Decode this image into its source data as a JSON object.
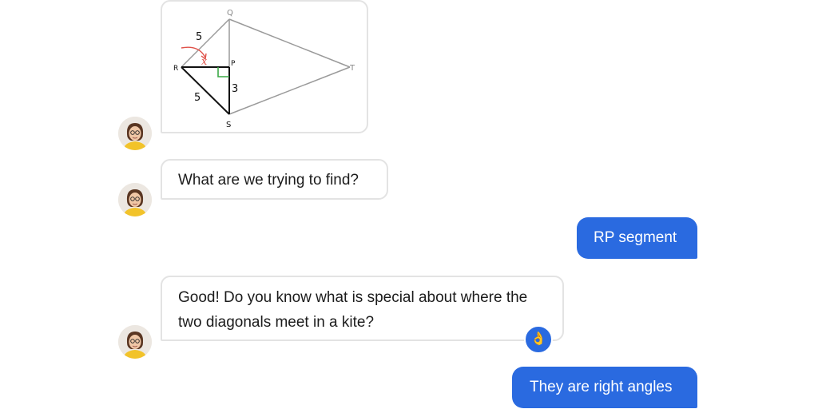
{
  "figure": {
    "vertex_q": "Q",
    "vertex_r": "R",
    "vertex_p": "P",
    "vertex_t": "T",
    "vertex_s": "S",
    "len_rq": "5",
    "len_rs": "5",
    "len_ps": "3",
    "unknown_x": "x"
  },
  "messages": {
    "tutor_1": "What are we trying to find?",
    "user_1": "RP segment",
    "tutor_2_line1": "Good! Do you know what is special about where the",
    "tutor_2_line2": "two diagonals meet in a kite?",
    "user_2": "They are right angles"
  },
  "reaction": {
    "icon": "ok-hand-icon",
    "glyph": "👌"
  },
  "colors": {
    "user_bubble": "#2a6ae0",
    "tutor_border": "#e3e3e3",
    "unknown_mark": "#e0524a",
    "right_angle_mark": "#3aa845"
  }
}
